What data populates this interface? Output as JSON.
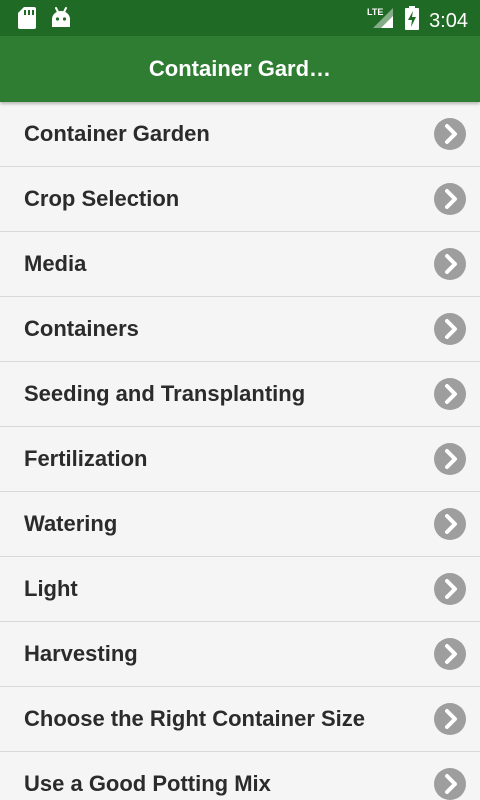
{
  "status_bar": {
    "network_label": "LTE",
    "time": "3:04"
  },
  "app_bar": {
    "title": "Container Gard…"
  },
  "list": {
    "items": [
      {
        "label": "Container Garden"
      },
      {
        "label": "Crop Selection"
      },
      {
        "label": "Media"
      },
      {
        "label": "Containers"
      },
      {
        "label": "Seeding and Transplanting"
      },
      {
        "label": "Fertilization"
      },
      {
        "label": "Watering"
      },
      {
        "label": "Light"
      },
      {
        "label": "Harvesting"
      },
      {
        "label": "Choose the Right Container Size"
      },
      {
        "label": "Use a Good Potting Mix"
      }
    ]
  },
  "colors": {
    "status_bar_bg": "#1f6b26",
    "app_bar_bg": "#2e7d32",
    "list_bg": "#f5f5f5",
    "chevron_bg": "#9e9e9e"
  }
}
